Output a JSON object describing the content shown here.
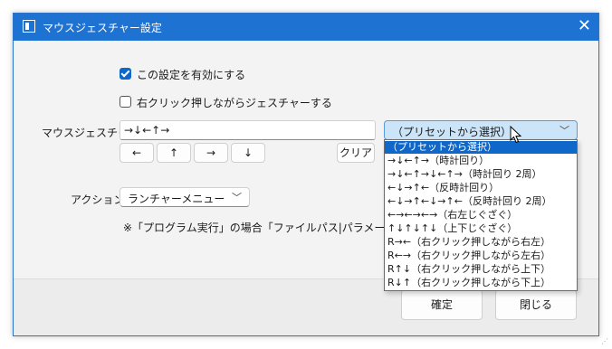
{
  "window": {
    "title": "マウスジェスチャー設定",
    "close_glyph": "✕"
  },
  "options": {
    "enable_label": "この設定を有効にする",
    "enable_checked": true,
    "right_click_label": "右クリック押しながらジェスチャーする",
    "right_click_checked": false
  },
  "gesture": {
    "label": "マウスジェスチャー",
    "value": "→↓←↑→",
    "buttons": [
      "←",
      "↑",
      "→",
      "↓"
    ],
    "clear_label": "クリア"
  },
  "preset": {
    "selected": "（プリセットから選択）",
    "chevron": "﹀",
    "items": [
      "（プリセットから選択）",
      "→↓←↑→（時計回り）",
      "→↓←↑→↓←↑→（時計回り 2周）",
      "←↓→↑←（反時計回り）",
      "←↓→↑←↓→↑←（反時計回り 2周）",
      "←→←→←→（右左じぐざぐ）",
      "↑↓↑↓↑↓（上下じぐざぐ）",
      "R→←（右クリック押しながら右左）",
      "R←→（右クリック押しながら左右）",
      "R↑↓（右クリック押しながら上下）",
      "R↓↑（右クリック押しながら下上）"
    ]
  },
  "action": {
    "label": "アクション",
    "selected": "ランチャーメニュー",
    "chevron": "﹀"
  },
  "note": "※「プログラム実行」の場合「ファイルパス|パラメータ」でパラメー",
  "footer": {
    "ok_label": "確定",
    "close_label": "閉じる"
  }
}
